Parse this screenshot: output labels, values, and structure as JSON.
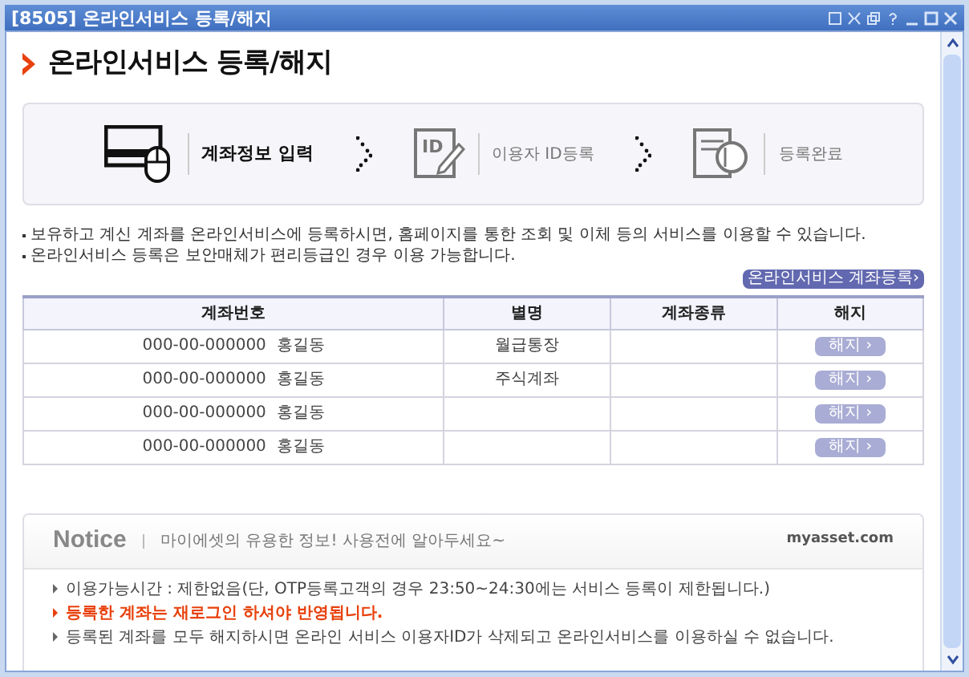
{
  "window": {
    "title": "[8505] 온라인서비스 등록/해지"
  },
  "heading": "온라인서비스 등록/해지",
  "steps": [
    {
      "kind": "account",
      "label": "계좌정보 입력",
      "selected": true
    },
    {
      "kind": "id",
      "icon_text": "ID",
      "label": "이용자 ID등록",
      "selected": false
    },
    {
      "kind": "done",
      "label": "등록완료",
      "selected": false
    }
  ],
  "info": [
    "보유하고 계신 계좌를 온라인서비스에 등록하시면, 홈페이지를 통한 조회 및 이체 등의 서비스를 이용할 수 있습니다.",
    "온라인서비스 등록은 보안매체가 편리등급인 경우 이용 가능합니다."
  ],
  "register_button": "온라인서비스 계좌등록›",
  "table": {
    "columns": [
      "계좌번호",
      "별명",
      "계좌종류",
      "해지"
    ],
    "rows": [
      {
        "account": "000-00-000000  홍길동",
        "nickname": "월급통장",
        "type": "",
        "action": "해지 ›"
      },
      {
        "account": "000-00-000000  홍길동",
        "nickname": "주식계좌",
        "type": "",
        "action": "해지 ›"
      },
      {
        "account": "000-00-000000  홍길동",
        "nickname": "",
        "type": "",
        "action": "해지 ›"
      },
      {
        "account": "000-00-000000  홍길동",
        "nickname": "",
        "type": "",
        "action": "해지 ›"
      }
    ]
  },
  "notice": {
    "title": "Notice",
    "subtitle": "마이에셋의 유용한 정보! 사용전에 알아두세요~",
    "brand": "myasset.com",
    "items": [
      {
        "text": "이용가능시간 : 제한없음(단, OTP등록고객의 경우 23:50~24:30에는 서비스 등록이 제한됩니다.)",
        "emphasis": false
      },
      {
        "text": "등록한 계좌는 재로그인 하셔야 반영됩니다.",
        "emphasis": true
      },
      {
        "text": "등록된 계좌를 모두 해지하시면 온라인 서비스 이용자ID가 삭제되고 온라인서비스를 이용하실 수 없습니다.",
        "emphasis": false
      }
    ]
  }
}
